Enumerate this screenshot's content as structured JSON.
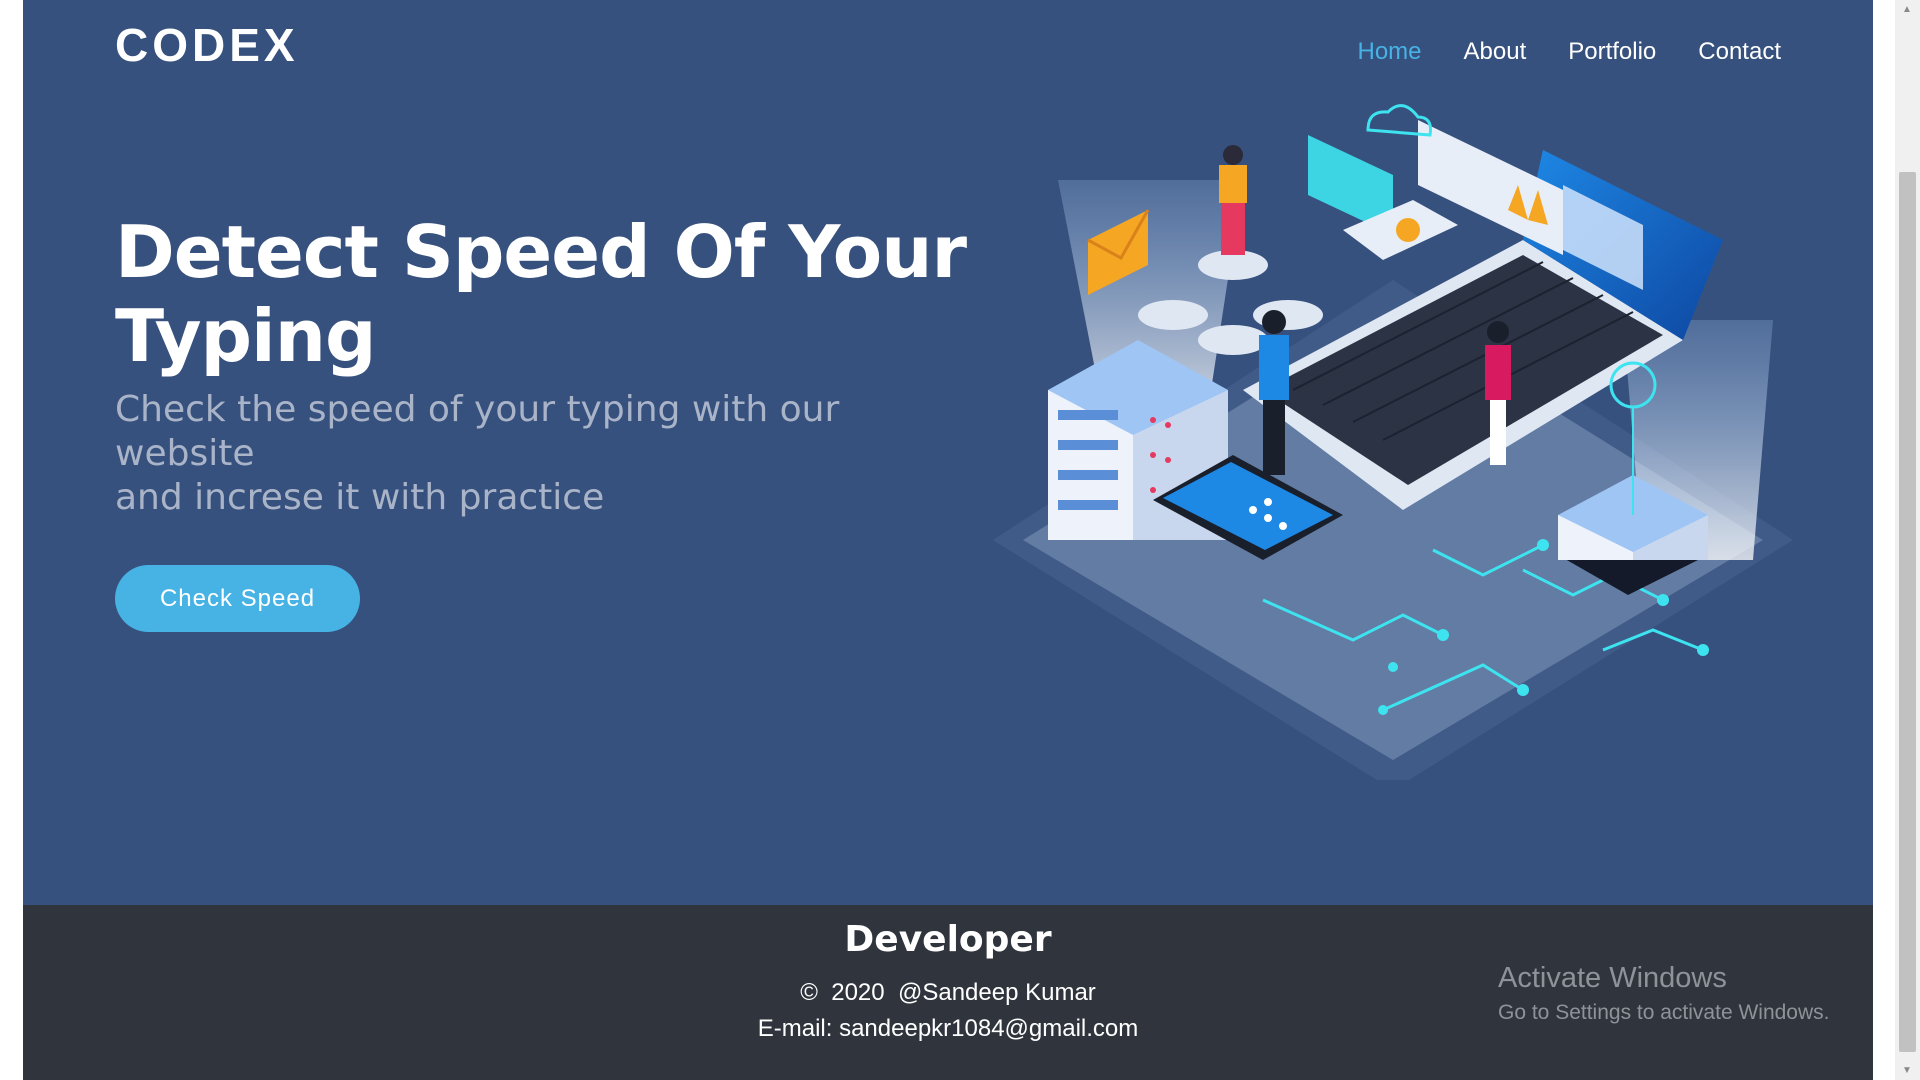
{
  "brand": {
    "logo": "CODEX"
  },
  "nav": {
    "items": [
      {
        "label": "Home",
        "active": true
      },
      {
        "label": "About",
        "active": false
      },
      {
        "label": "Portfolio",
        "active": false
      },
      {
        "label": "Contact",
        "active": false
      }
    ]
  },
  "hero": {
    "title_line1": "Detect Speed Of Your",
    "title_line2": "Typing",
    "subtitle_line1": "Check the speed of your typing with our website",
    "subtitle_line2": "and increse it with practice",
    "cta_label": "Check Speed"
  },
  "footer": {
    "title": "Developer",
    "copyright_symbol": "©",
    "year": "2020",
    "author": "@Sandeep Kumar",
    "email_line": "E-mail: sandeepkr1084@gmail.com"
  },
  "watermark": {
    "title": "Activate Windows",
    "subtitle": "Go to Settings to activate Windows."
  },
  "colors": {
    "hero_bg": "#37517e",
    "accent": "#47b2e4",
    "footer_bg": "#30353d"
  },
  "icons": [
    "hero-illustration",
    "scroll-up-arrow-icon",
    "scroll-down-arrow-icon"
  ]
}
